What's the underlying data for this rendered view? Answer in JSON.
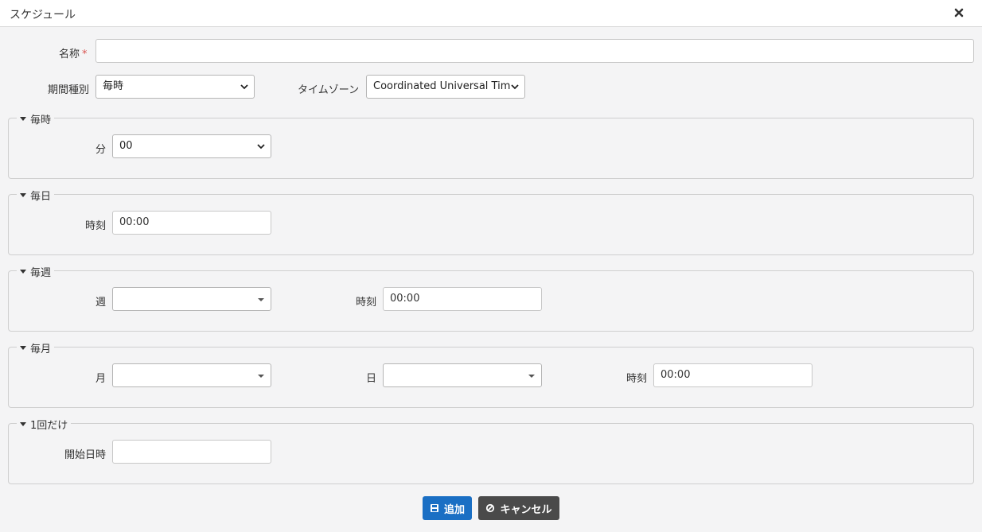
{
  "dialog": {
    "title": "スケジュール"
  },
  "form": {
    "name_label": "名称",
    "name_required_mark": "*",
    "name_value": "",
    "period_type_label": "期間種別",
    "period_type_value": "毎時",
    "timezone_label": "タイムゾーン",
    "timezone_value": "Coordinated Universal Tim"
  },
  "hourly": {
    "legend": "毎時",
    "minute_label": "分",
    "minute_value": "00"
  },
  "daily": {
    "legend": "毎日",
    "time_label": "時刻",
    "time_value": "00:00"
  },
  "weekly": {
    "legend": "毎週",
    "week_label": "週",
    "week_value": "",
    "time_label": "時刻",
    "time_value": "00:00"
  },
  "monthly": {
    "legend": "毎月",
    "month_label": "月",
    "month_value": "",
    "day_label": "日",
    "day_value": "",
    "time_label": "時刻",
    "time_value": "00:00"
  },
  "once": {
    "legend": "1回だけ",
    "start_label": "開始日時",
    "start_value": ""
  },
  "actions": {
    "add_label": "追加",
    "cancel_label": "キャンセル"
  },
  "colors": {
    "primary": "#1a6fc4",
    "dark": "#4a4a4a",
    "required": "#d9534f"
  }
}
